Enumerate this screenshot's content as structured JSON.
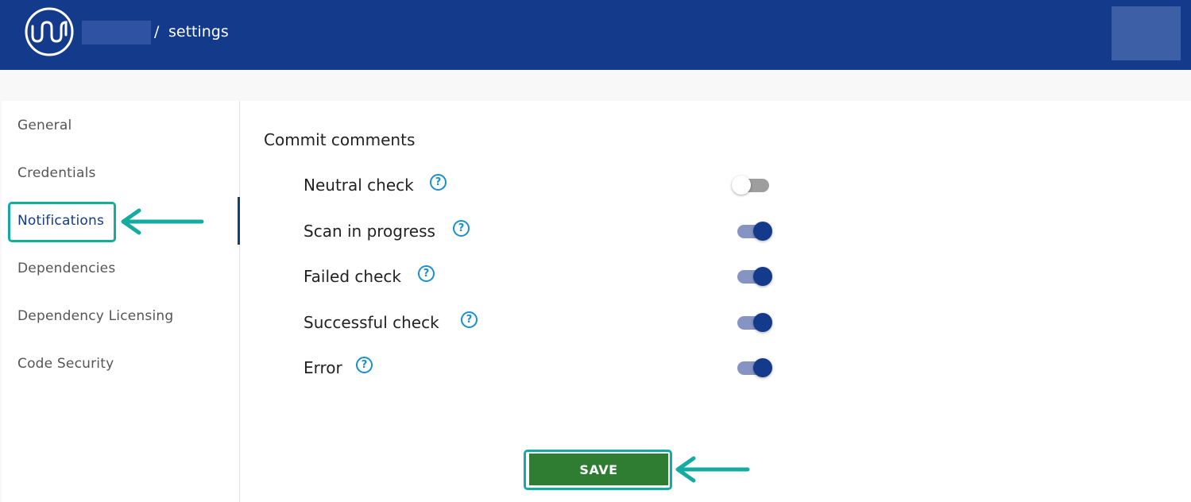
{
  "header": {
    "separator": "/",
    "page": "settings",
    "logo_icon": "wave-logo-icon",
    "colors": {
      "bar": "#143a8c"
    }
  },
  "sidebar": {
    "items": [
      {
        "label": "General"
      },
      {
        "label": "Credentials"
      },
      {
        "label": "Notifications"
      },
      {
        "label": "Dependencies"
      },
      {
        "label": "Dependency Licensing"
      },
      {
        "label": "Code Security"
      }
    ],
    "active": "Notifications"
  },
  "main": {
    "section_title": "Commit comments",
    "help_icon": "question-circle-icon",
    "rows": [
      {
        "label": "Neutral check",
        "enabled": false
      },
      {
        "label": "Scan in progress",
        "enabled": true
      },
      {
        "label": "Failed check",
        "enabled": true
      },
      {
        "label": "Successful check",
        "enabled": true
      },
      {
        "label": "Error",
        "enabled": true
      }
    ],
    "save_label": "SAVE"
  },
  "annotations": {
    "highlight_color": "#14aba0",
    "arrow_icon": "left-arrow-icon"
  },
  "colors": {
    "accent": "#143a8c",
    "help": "#1a8fd0",
    "save": "#2e7d32"
  }
}
